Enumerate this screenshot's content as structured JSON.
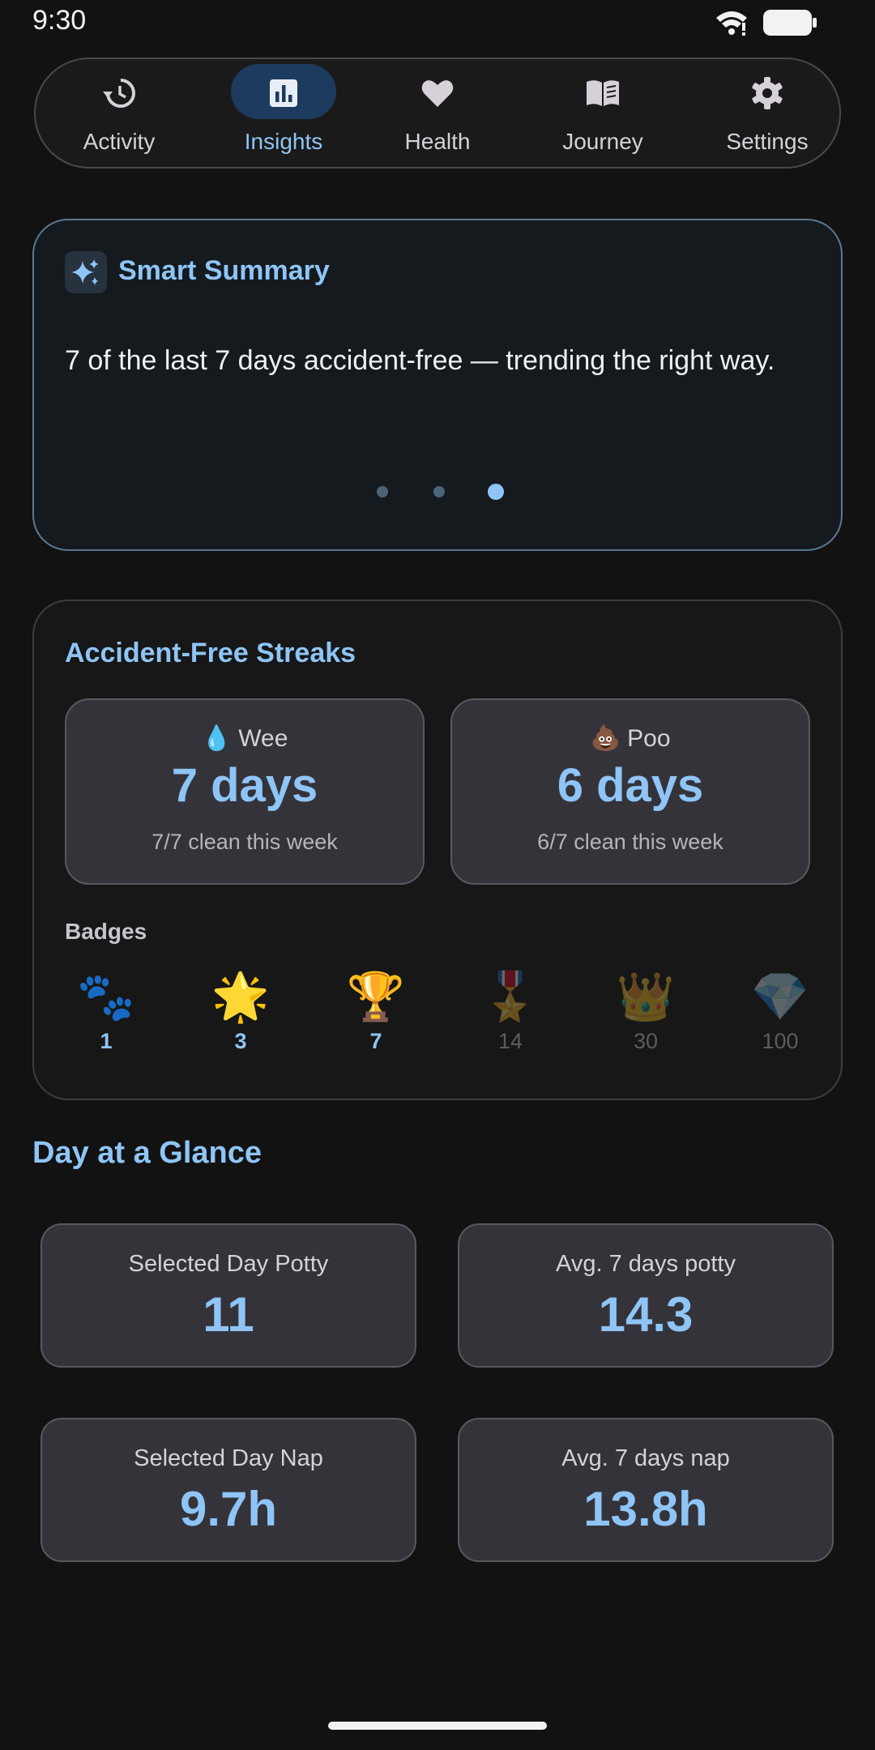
{
  "status_bar": {
    "time": "9:30"
  },
  "nav": {
    "items": [
      {
        "label": "Activity",
        "icon": "history-icon",
        "active": false
      },
      {
        "label": "Insights",
        "icon": "bar-chart-icon",
        "active": true
      },
      {
        "label": "Health",
        "icon": "heart-icon",
        "active": false
      },
      {
        "label": "Journey",
        "icon": "book-icon",
        "active": false
      },
      {
        "label": "Settings",
        "icon": "gear-icon",
        "active": false
      }
    ]
  },
  "summary": {
    "title": "Smart Summary",
    "icon": "sparkle-icon",
    "text": "7 of the last 7 days accident-free — trending the right way.",
    "page_count": 3,
    "active_page": 3
  },
  "streaks": {
    "title": "Accident-Free Streaks",
    "wee": {
      "emoji": "💧",
      "label": "Wee",
      "value": "7 days",
      "sub": "7/7 clean this week"
    },
    "poo": {
      "emoji": "💩",
      "label": "Poo",
      "value": "6 days",
      "sub": "6/7 clean this week"
    },
    "badges_title": "Badges",
    "badges": [
      {
        "emoji": "🐾",
        "days": "1",
        "unlocked": true
      },
      {
        "emoji": "🌟",
        "days": "3",
        "unlocked": true
      },
      {
        "emoji": "🏆",
        "days": "7",
        "unlocked": true
      },
      {
        "emoji": "🎖️",
        "days": "14",
        "unlocked": false
      },
      {
        "emoji": "👑",
        "days": "30",
        "unlocked": false
      },
      {
        "emoji": "💎",
        "days": "100",
        "unlocked": false
      }
    ]
  },
  "glance": {
    "title": "Day at a Glance",
    "selected_potty": {
      "label": "Selected Day Potty",
      "value": "11"
    },
    "avg_potty": {
      "label": "Avg. 7 days potty",
      "value": "14.3"
    },
    "selected_nap": {
      "label": "Selected Day Nap",
      "value": "9.7h"
    },
    "avg_nap": {
      "label": "Avg. 7 days nap",
      "value": "13.8h"
    }
  },
  "colors": {
    "accent": "#8ec5f6",
    "background": "#121212",
    "card": "#35333a"
  }
}
